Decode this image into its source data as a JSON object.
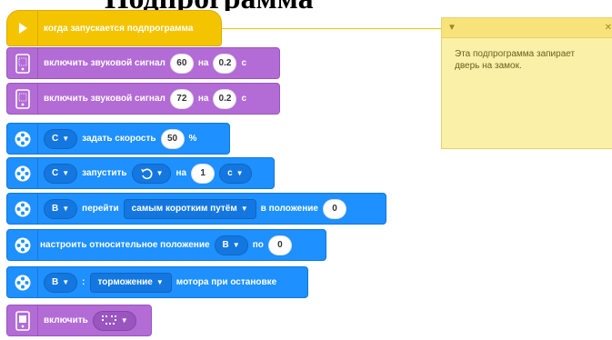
{
  "page_title": "Подпрограмма",
  "comment": {
    "text": "Эта подпрограмма запирает\nдверь на замок."
  },
  "blocks": {
    "hat": {
      "label": "когда запускается подпрограмма"
    },
    "beep1": {
      "label": "включить звуковой сигнал",
      "note": "60",
      "for_label": "на",
      "duration": "0.2",
      "unit": "с"
    },
    "beep2": {
      "label": "включить звуковой сигнал",
      "note": "72",
      "for_label": "на",
      "duration": "0.2",
      "unit": "с"
    },
    "set_speed": {
      "port": "C",
      "label": "задать скорость",
      "value": "50",
      "unit": "%"
    },
    "run_motor": {
      "port": "C",
      "label": "запустить",
      "for_label": "на",
      "value": "1",
      "unit_dropdown": "с"
    },
    "go_to": {
      "port": "B",
      "label": "перейти",
      "mode": "самым коротким путём",
      "to_label": "в положение",
      "value": "0"
    },
    "set_relative": {
      "label": "настроить относительное положение",
      "port": "B",
      "by_label": "по",
      "value": "0"
    },
    "stop_action": {
      "port": "B",
      "colon": ":",
      "mode": "торможение",
      "label": "мотора при остановке"
    },
    "light": {
      "label": "включить"
    }
  },
  "colors": {
    "events": "#f5c400",
    "sound": "#b36bd6",
    "motor": "#1e90ff",
    "comment": "#fbf0a8"
  },
  "icons": {
    "hat": "play-icon",
    "sound": "hub-icon",
    "motor": "motor-icon",
    "light": "hub-light-icon",
    "direction": "counterclockwise-arrow-icon"
  }
}
